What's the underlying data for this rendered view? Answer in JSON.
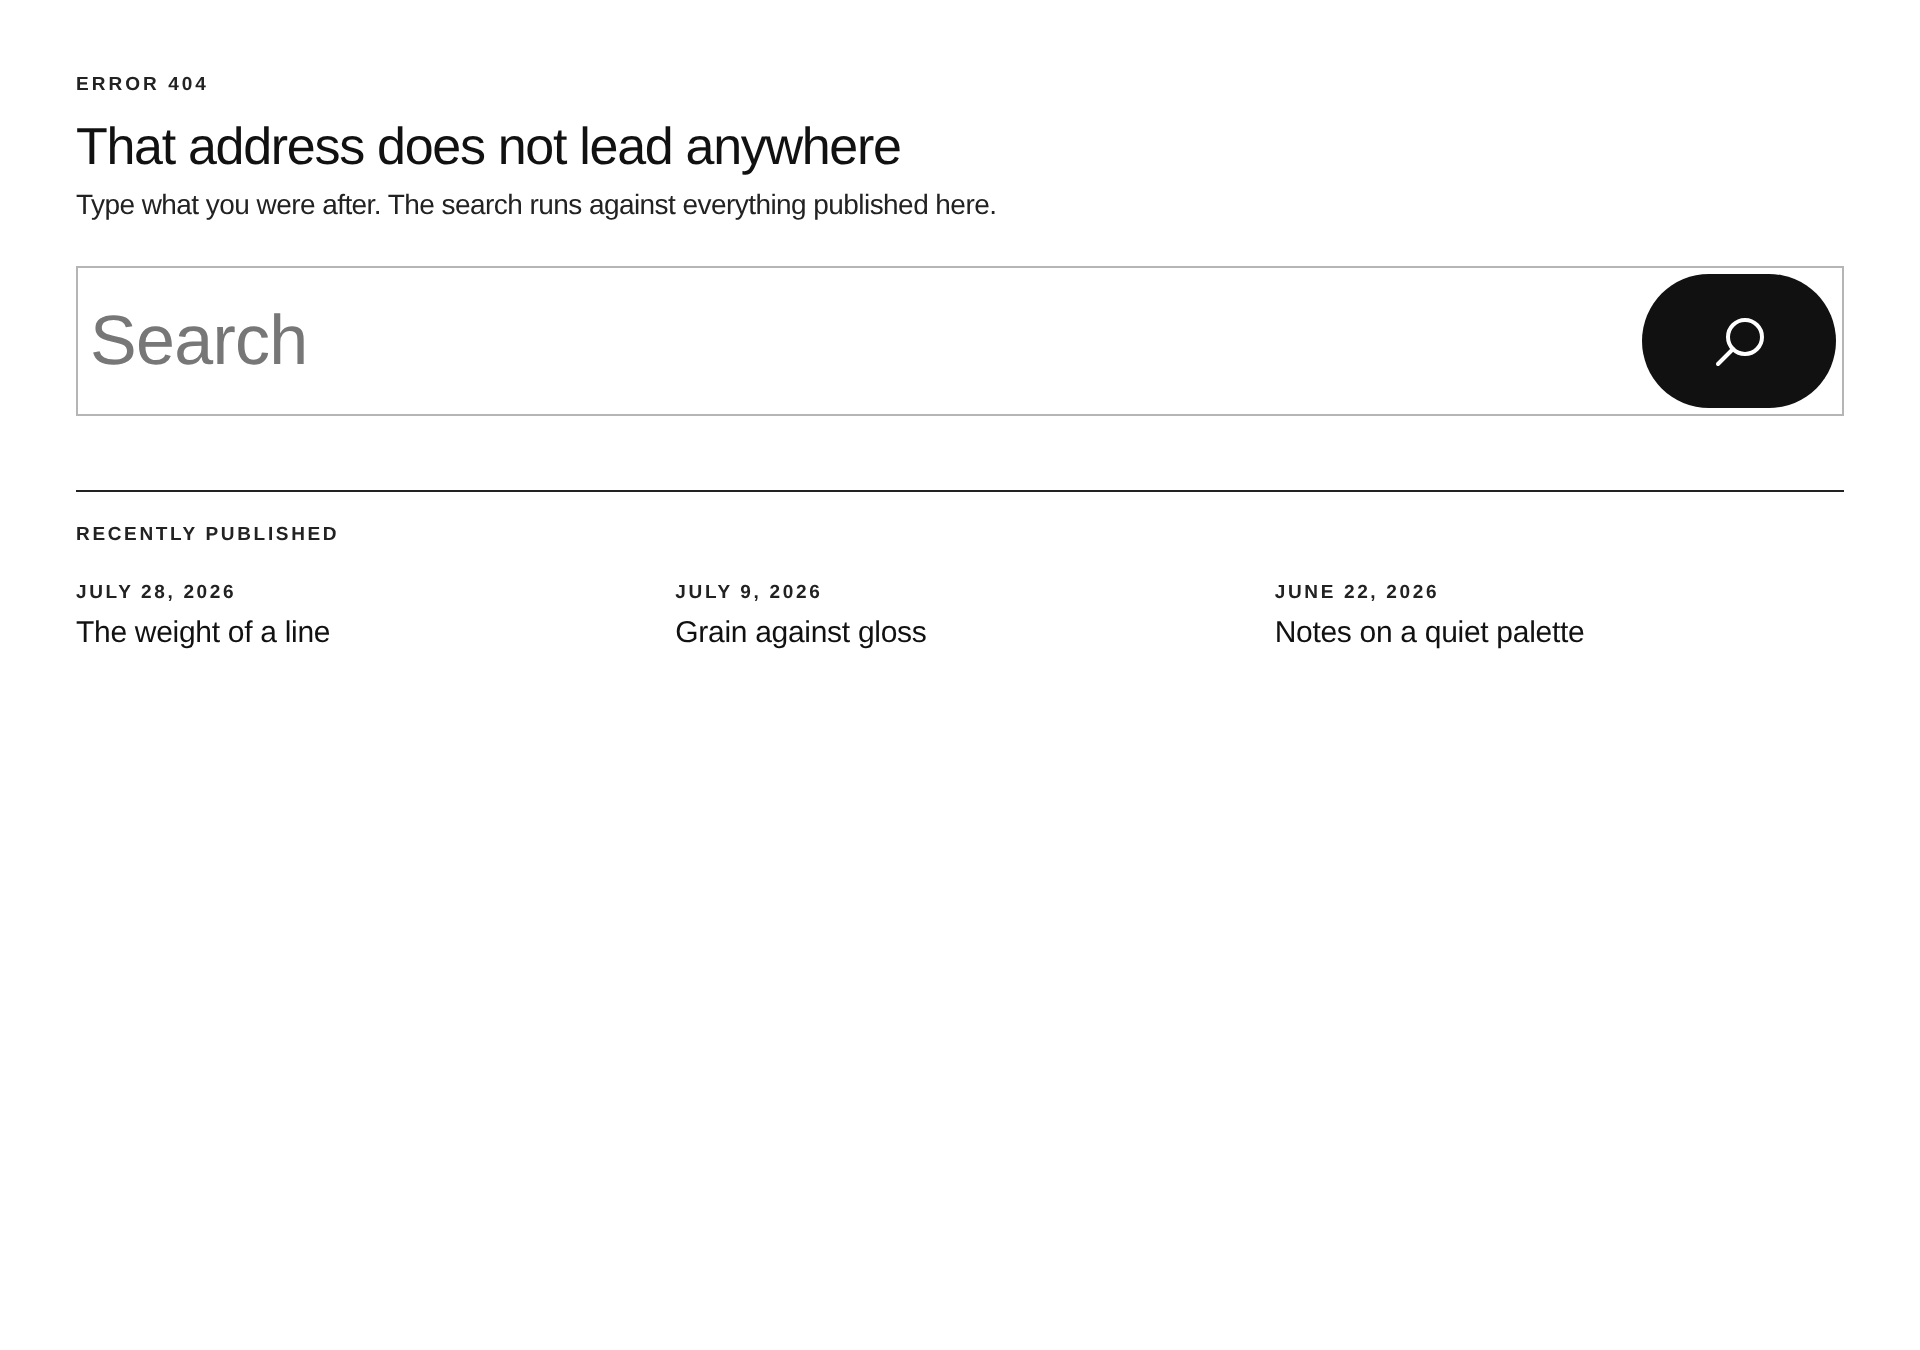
{
  "eyebrow": "ERROR 404",
  "title": "That address does not lead anywhere",
  "subtitle": "Type what you were after. The search runs against everything published here.",
  "search": {
    "placeholder": "Search"
  },
  "recent": {
    "heading": "RECENTLY PUBLISHED",
    "posts": [
      {
        "date": "JULY 28, 2026",
        "title": "The weight of a line"
      },
      {
        "date": "JULY 9, 2026",
        "title": "Grain against gloss"
      },
      {
        "date": "JUNE 22, 2026",
        "title": "Notes on a quiet palette"
      }
    ]
  }
}
